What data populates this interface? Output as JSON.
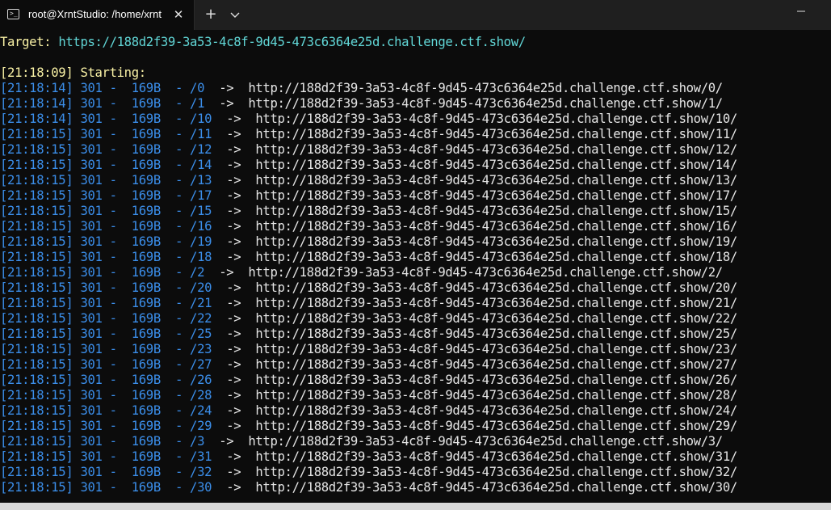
{
  "window": {
    "tab_title": "root@XrntStudio: /home/xrnt",
    "tab_icon_glyph": ">_",
    "close_glyph": "✕",
    "new_tab_glyph": "+",
    "icons": [
      "terminal-icon",
      "close-icon",
      "plus-icon",
      "chevron-down-icon",
      "minimize-icon"
    ]
  },
  "terminal": {
    "target_label": "Target:",
    "target_url": "https://188d2f39-3a53-4c8f-9d45-473c6364e25d.challenge.ctf.show/",
    "start_time": "[21:18:09]",
    "start_text": "Starting:",
    "arrow": "->",
    "rows": [
      {
        "time": "[21:18:14]",
        "status": "301",
        "size": "169B",
        "path": "/0",
        "url": "http://188d2f39-3a53-4c8f-9d45-473c6364e25d.challenge.ctf.show/0/"
      },
      {
        "time": "[21:18:14]",
        "status": "301",
        "size": "169B",
        "path": "/1",
        "url": "http://188d2f39-3a53-4c8f-9d45-473c6364e25d.challenge.ctf.show/1/"
      },
      {
        "time": "[21:18:14]",
        "status": "301",
        "size": "169B",
        "path": "/10",
        "url": "http://188d2f39-3a53-4c8f-9d45-473c6364e25d.challenge.ctf.show/10/"
      },
      {
        "time": "[21:18:15]",
        "status": "301",
        "size": "169B",
        "path": "/11",
        "url": "http://188d2f39-3a53-4c8f-9d45-473c6364e25d.challenge.ctf.show/11/"
      },
      {
        "time": "[21:18:15]",
        "status": "301",
        "size": "169B",
        "path": "/12",
        "url": "http://188d2f39-3a53-4c8f-9d45-473c6364e25d.challenge.ctf.show/12/"
      },
      {
        "time": "[21:18:15]",
        "status": "301",
        "size": "169B",
        "path": "/14",
        "url": "http://188d2f39-3a53-4c8f-9d45-473c6364e25d.challenge.ctf.show/14/"
      },
      {
        "time": "[21:18:15]",
        "status": "301",
        "size": "169B",
        "path": "/13",
        "url": "http://188d2f39-3a53-4c8f-9d45-473c6364e25d.challenge.ctf.show/13/"
      },
      {
        "time": "[21:18:15]",
        "status": "301",
        "size": "169B",
        "path": "/17",
        "url": "http://188d2f39-3a53-4c8f-9d45-473c6364e25d.challenge.ctf.show/17/"
      },
      {
        "time": "[21:18:15]",
        "status": "301",
        "size": "169B",
        "path": "/15",
        "url": "http://188d2f39-3a53-4c8f-9d45-473c6364e25d.challenge.ctf.show/15/"
      },
      {
        "time": "[21:18:15]",
        "status": "301",
        "size": "169B",
        "path": "/16",
        "url": "http://188d2f39-3a53-4c8f-9d45-473c6364e25d.challenge.ctf.show/16/"
      },
      {
        "time": "[21:18:15]",
        "status": "301",
        "size": "169B",
        "path": "/19",
        "url": "http://188d2f39-3a53-4c8f-9d45-473c6364e25d.challenge.ctf.show/19/"
      },
      {
        "time": "[21:18:15]",
        "status": "301",
        "size": "169B",
        "path": "/18",
        "url": "http://188d2f39-3a53-4c8f-9d45-473c6364e25d.challenge.ctf.show/18/"
      },
      {
        "time": "[21:18:15]",
        "status": "301",
        "size": "169B",
        "path": "/2",
        "url": "http://188d2f39-3a53-4c8f-9d45-473c6364e25d.challenge.ctf.show/2/"
      },
      {
        "time": "[21:18:15]",
        "status": "301",
        "size": "169B",
        "path": "/20",
        "url": "http://188d2f39-3a53-4c8f-9d45-473c6364e25d.challenge.ctf.show/20/"
      },
      {
        "time": "[21:18:15]",
        "status": "301",
        "size": "169B",
        "path": "/21",
        "url": "http://188d2f39-3a53-4c8f-9d45-473c6364e25d.challenge.ctf.show/21/"
      },
      {
        "time": "[21:18:15]",
        "status": "301",
        "size": "169B",
        "path": "/22",
        "url": "http://188d2f39-3a53-4c8f-9d45-473c6364e25d.challenge.ctf.show/22/"
      },
      {
        "time": "[21:18:15]",
        "status": "301",
        "size": "169B",
        "path": "/25",
        "url": "http://188d2f39-3a53-4c8f-9d45-473c6364e25d.challenge.ctf.show/25/"
      },
      {
        "time": "[21:18:15]",
        "status": "301",
        "size": "169B",
        "path": "/23",
        "url": "http://188d2f39-3a53-4c8f-9d45-473c6364e25d.challenge.ctf.show/23/"
      },
      {
        "time": "[21:18:15]",
        "status": "301",
        "size": "169B",
        "path": "/27",
        "url": "http://188d2f39-3a53-4c8f-9d45-473c6364e25d.challenge.ctf.show/27/"
      },
      {
        "time": "[21:18:15]",
        "status": "301",
        "size": "169B",
        "path": "/26",
        "url": "http://188d2f39-3a53-4c8f-9d45-473c6364e25d.challenge.ctf.show/26/"
      },
      {
        "time": "[21:18:15]",
        "status": "301",
        "size": "169B",
        "path": "/28",
        "url": "http://188d2f39-3a53-4c8f-9d45-473c6364e25d.challenge.ctf.show/28/"
      },
      {
        "time": "[21:18:15]",
        "status": "301",
        "size": "169B",
        "path": "/24",
        "url": "http://188d2f39-3a53-4c8f-9d45-473c6364e25d.challenge.ctf.show/24/"
      },
      {
        "time": "[21:18:15]",
        "status": "301",
        "size": "169B",
        "path": "/29",
        "url": "http://188d2f39-3a53-4c8f-9d45-473c6364e25d.challenge.ctf.show/29/"
      },
      {
        "time": "[21:18:15]",
        "status": "301",
        "size": "169B",
        "path": "/3",
        "url": "http://188d2f39-3a53-4c8f-9d45-473c6364e25d.challenge.ctf.show/3/"
      },
      {
        "time": "[21:18:15]",
        "status": "301",
        "size": "169B",
        "path": "/31",
        "url": "http://188d2f39-3a53-4c8f-9d45-473c6364e25d.challenge.ctf.show/31/"
      },
      {
        "time": "[21:18:15]",
        "status": "301",
        "size": "169B",
        "path": "/32",
        "url": "http://188d2f39-3a53-4c8f-9d45-473c6364e25d.challenge.ctf.show/32/"
      },
      {
        "time": "[21:18:15]",
        "status": "301",
        "size": "169B",
        "path": "/30",
        "url": "http://188d2f39-3a53-4c8f-9d45-473c6364e25d.challenge.ctf.show/30/"
      }
    ]
  }
}
